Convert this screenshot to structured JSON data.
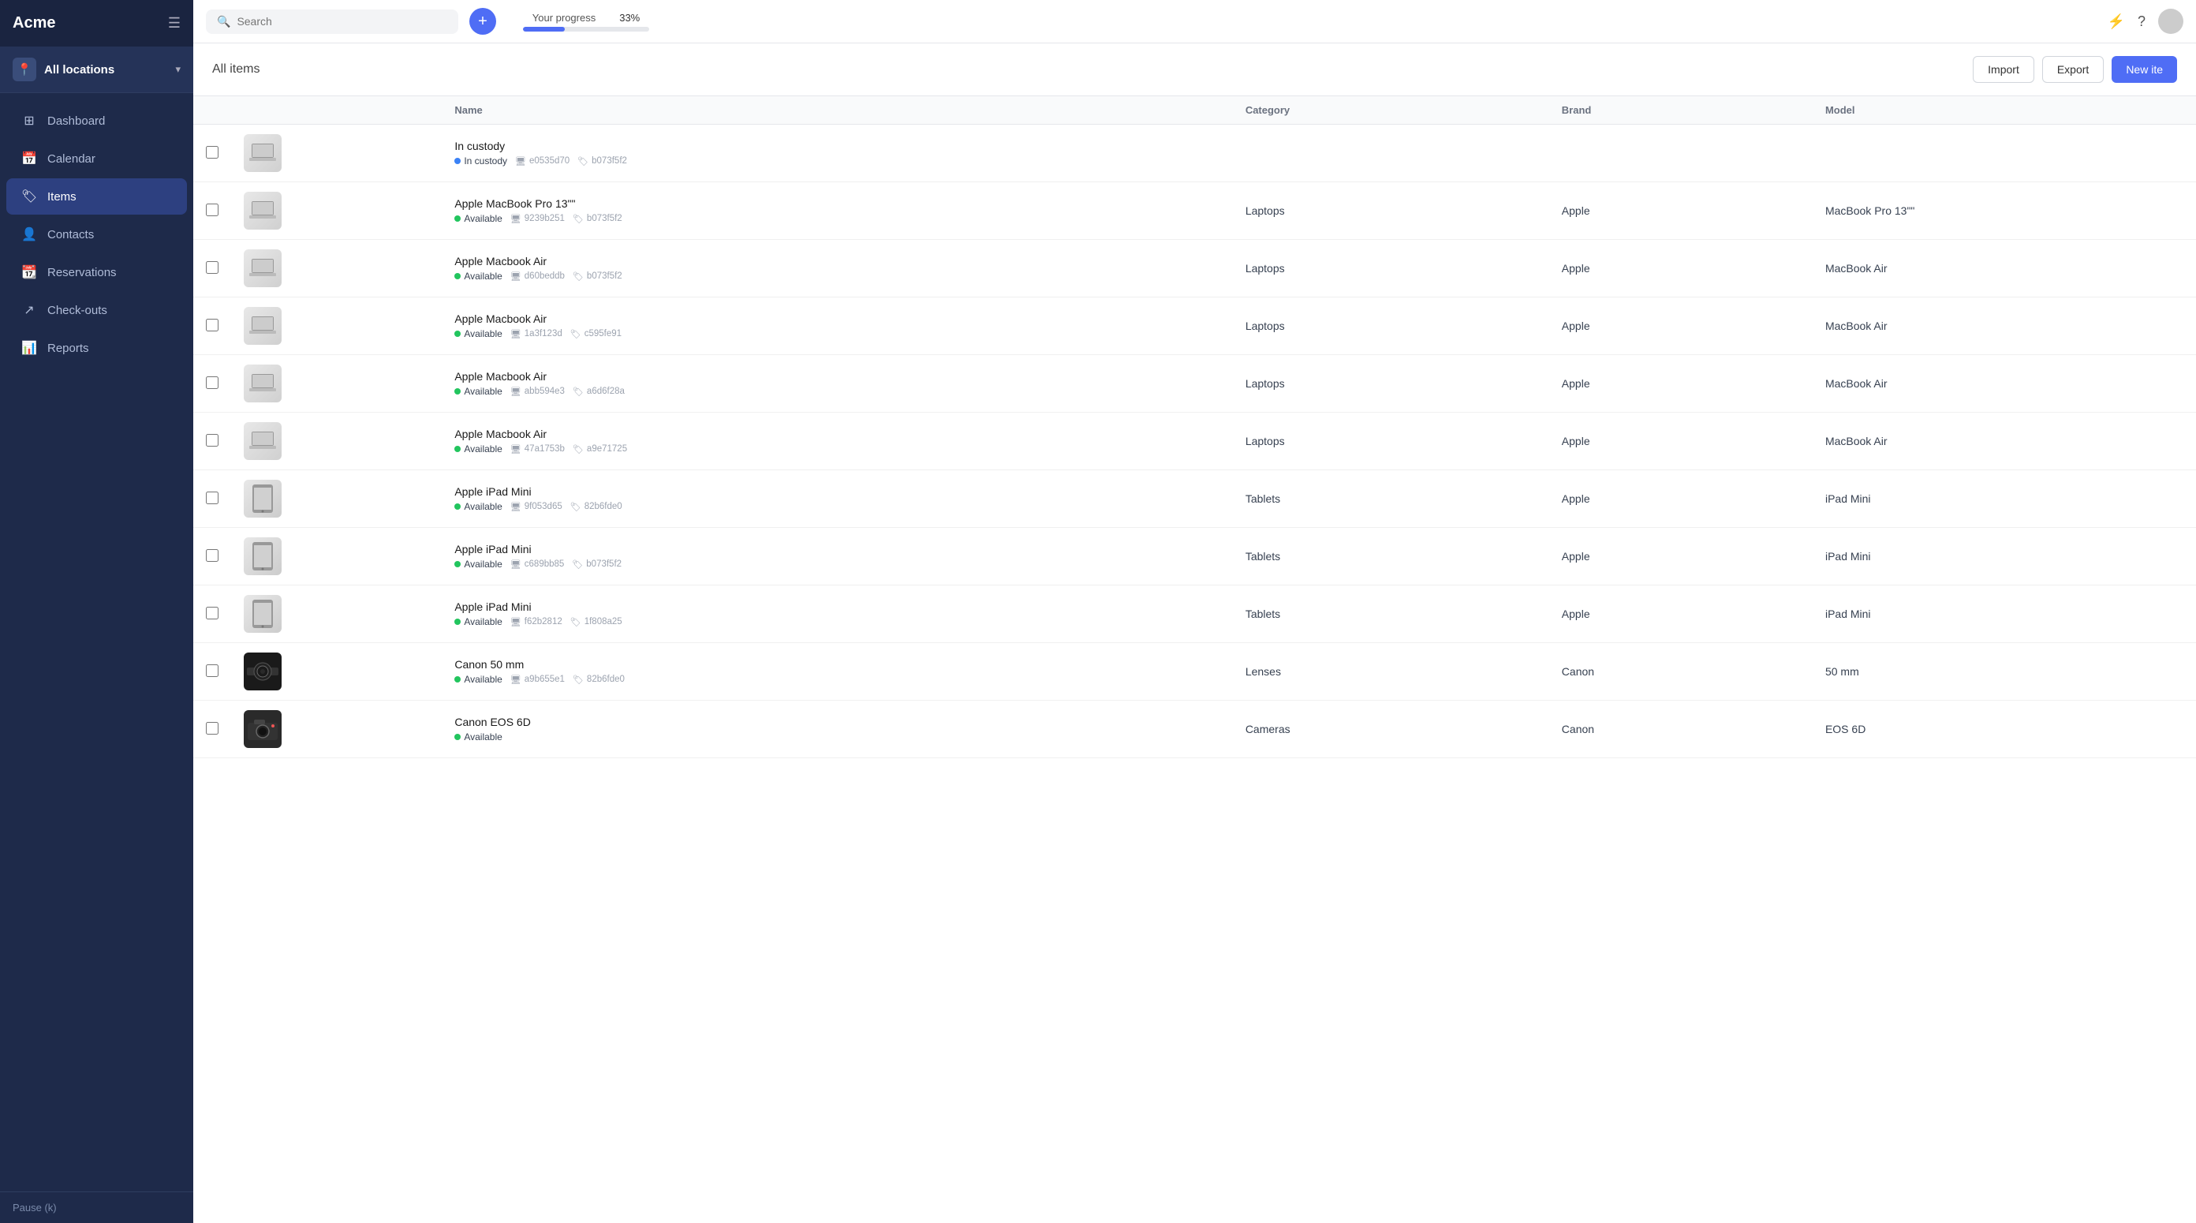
{
  "app": {
    "name": "Acme"
  },
  "sidebar": {
    "location": "All locations",
    "nav_items": [
      {
        "id": "dashboard",
        "label": "Dashboard",
        "icon": "⊞"
      },
      {
        "id": "calendar",
        "label": "Calendar",
        "icon": "📅"
      },
      {
        "id": "items",
        "label": "Items",
        "icon": "🏷",
        "active": true
      },
      {
        "id": "contacts",
        "label": "Contacts",
        "icon": "👤"
      },
      {
        "id": "reservations",
        "label": "Reservations",
        "icon": "📆"
      },
      {
        "id": "checkouts",
        "label": "Check-outs",
        "icon": "↗"
      },
      {
        "id": "reports",
        "label": "Reports",
        "icon": "📊"
      }
    ],
    "footer_label": "Pause (k)"
  },
  "topbar": {
    "search_placeholder": "Search",
    "add_button_label": "+",
    "progress": {
      "label": "Your progress",
      "percent": "33%",
      "value": 33
    }
  },
  "page": {
    "title": "All items",
    "import_label": "Import",
    "export_label": "Export",
    "new_item_label": "New ite"
  },
  "table": {
    "columns": [
      "",
      "",
      "Name",
      "Category",
      "Brand",
      "Model"
    ],
    "rows": [
      {
        "id": "row-custody",
        "name": "In custody",
        "status": "custody",
        "status_label": "In custody",
        "id1": "e0535d70",
        "id2": "b073f5f2",
        "category": "",
        "brand": "",
        "model": "",
        "thumb": "laptop",
        "thumb_emoji": "💻"
      },
      {
        "id": "row-1",
        "name": "Apple MacBook Pro 13\"\"",
        "status": "available",
        "status_label": "Available",
        "id1": "9239b251",
        "id2": "b073f5f2",
        "category": "Laptops",
        "brand": "Apple",
        "model": "MacBook Pro 13\"\"",
        "thumb": "laptop",
        "thumb_emoji": "💻"
      },
      {
        "id": "row-2",
        "name": "Apple Macbook Air",
        "status": "available",
        "status_label": "Available",
        "id1": "d60beddb",
        "id2": "b073f5f2",
        "category": "Laptops",
        "brand": "Apple",
        "model": "MacBook Air",
        "thumb": "laptop",
        "thumb_emoji": "💻"
      },
      {
        "id": "row-3",
        "name": "Apple Macbook Air",
        "status": "available",
        "status_label": "Available",
        "id1": "1a3f123d",
        "id2": "c595fe91",
        "category": "Laptops",
        "brand": "Apple",
        "model": "MacBook Air",
        "thumb": "laptop",
        "thumb_emoji": "💻"
      },
      {
        "id": "row-4",
        "name": "Apple Macbook Air",
        "status": "available",
        "status_label": "Available",
        "id1": "abb594e3",
        "id2": "a6d6f28a",
        "category": "Laptops",
        "brand": "Apple",
        "model": "MacBook Air",
        "thumb": "laptop",
        "thumb_emoji": "💻"
      },
      {
        "id": "row-5",
        "name": "Apple Macbook Air",
        "status": "available",
        "status_label": "Available",
        "id1": "47a1753b",
        "id2": "a9e71725",
        "category": "Laptops",
        "brand": "Apple",
        "model": "MacBook Air",
        "thumb": "laptop",
        "thumb_emoji": "💻"
      },
      {
        "id": "row-6",
        "name": "Apple iPad Mini",
        "status": "available",
        "status_label": "Available",
        "id1": "9f053d65",
        "id2": "82b6fde0",
        "category": "Tablets",
        "brand": "Apple",
        "model": "iPad Mini",
        "thumb": "tablet",
        "thumb_emoji": "📱"
      },
      {
        "id": "row-7",
        "name": "Apple iPad Mini",
        "status": "available",
        "status_label": "Available",
        "id1": "c689bb85",
        "id2": "b073f5f2",
        "category": "Tablets",
        "brand": "Apple",
        "model": "iPad Mini",
        "thumb": "tablet",
        "thumb_emoji": "📱"
      },
      {
        "id": "row-8",
        "name": "Apple iPad Mini",
        "status": "available",
        "status_label": "Available",
        "id1": "f62b2812",
        "id2": "1f808a25",
        "category": "Tablets",
        "brand": "Apple",
        "model": "iPad Mini",
        "thumb": "tablet",
        "thumb_emoji": "📱"
      },
      {
        "id": "row-9",
        "name": "Canon 50 mm",
        "status": "available",
        "status_label": "Available",
        "id1": "a9b655e1",
        "id2": "82b6fde0",
        "category": "Lenses",
        "brand": "Canon",
        "model": "50 mm",
        "thumb": "lens",
        "thumb_emoji": "🔭"
      },
      {
        "id": "row-10",
        "name": "Canon EOS 6D",
        "status": "available",
        "status_label": "Available",
        "id1": "",
        "id2": "",
        "category": "Cameras",
        "brand": "Canon",
        "model": "EOS 6D",
        "thumb": "camera",
        "thumb_emoji": "📷"
      }
    ]
  }
}
